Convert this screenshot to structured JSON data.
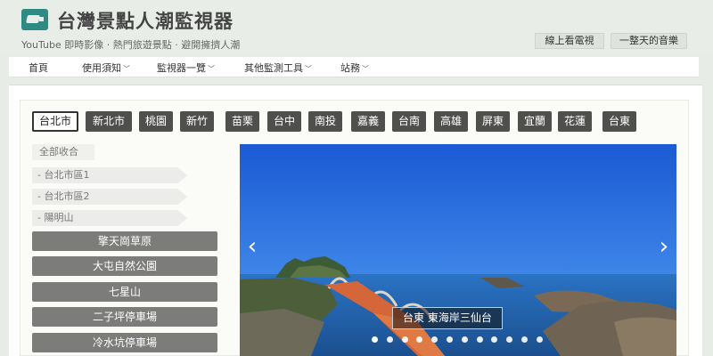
{
  "header": {
    "title": "台灣景點人潮監視器",
    "subtitle": "YouTube 即時影像 · 熱門旅遊景點 · 避開擁擠人潮",
    "buttons": [
      "線上看電視",
      "一整天的音樂"
    ]
  },
  "nav": {
    "items": [
      {
        "label": "首頁"
      },
      {
        "label": "使用須知"
      },
      {
        "label": "監視器一覽"
      },
      {
        "label": "其他監測工具"
      },
      {
        "label": "站務"
      }
    ]
  },
  "cities": {
    "active": "台北市",
    "items": [
      "台北市",
      "新北市",
      "桃園",
      "新竹",
      "苗栗",
      "台中",
      "南投",
      "嘉義",
      "台南",
      "高雄",
      "屏東",
      "宜蘭",
      "花蓮",
      "台東"
    ]
  },
  "sidebar": {
    "collapse_label": "全部收合",
    "regions": [
      "- 台北市區1",
      "- 台北市區2",
      "- 陽明山"
    ],
    "spots": [
      "擎天崗草原",
      "大屯自然公園",
      "七星山",
      "二子坪停車場",
      "冷水坑停車場"
    ]
  },
  "slideshow": {
    "caption": "台東 東海岸三仙台",
    "dot_count": 12,
    "active_dot": 0,
    "colors": {
      "sky": "#1f62d6",
      "sea": "#1d5fb0",
      "bridge": "#d4663a"
    }
  }
}
